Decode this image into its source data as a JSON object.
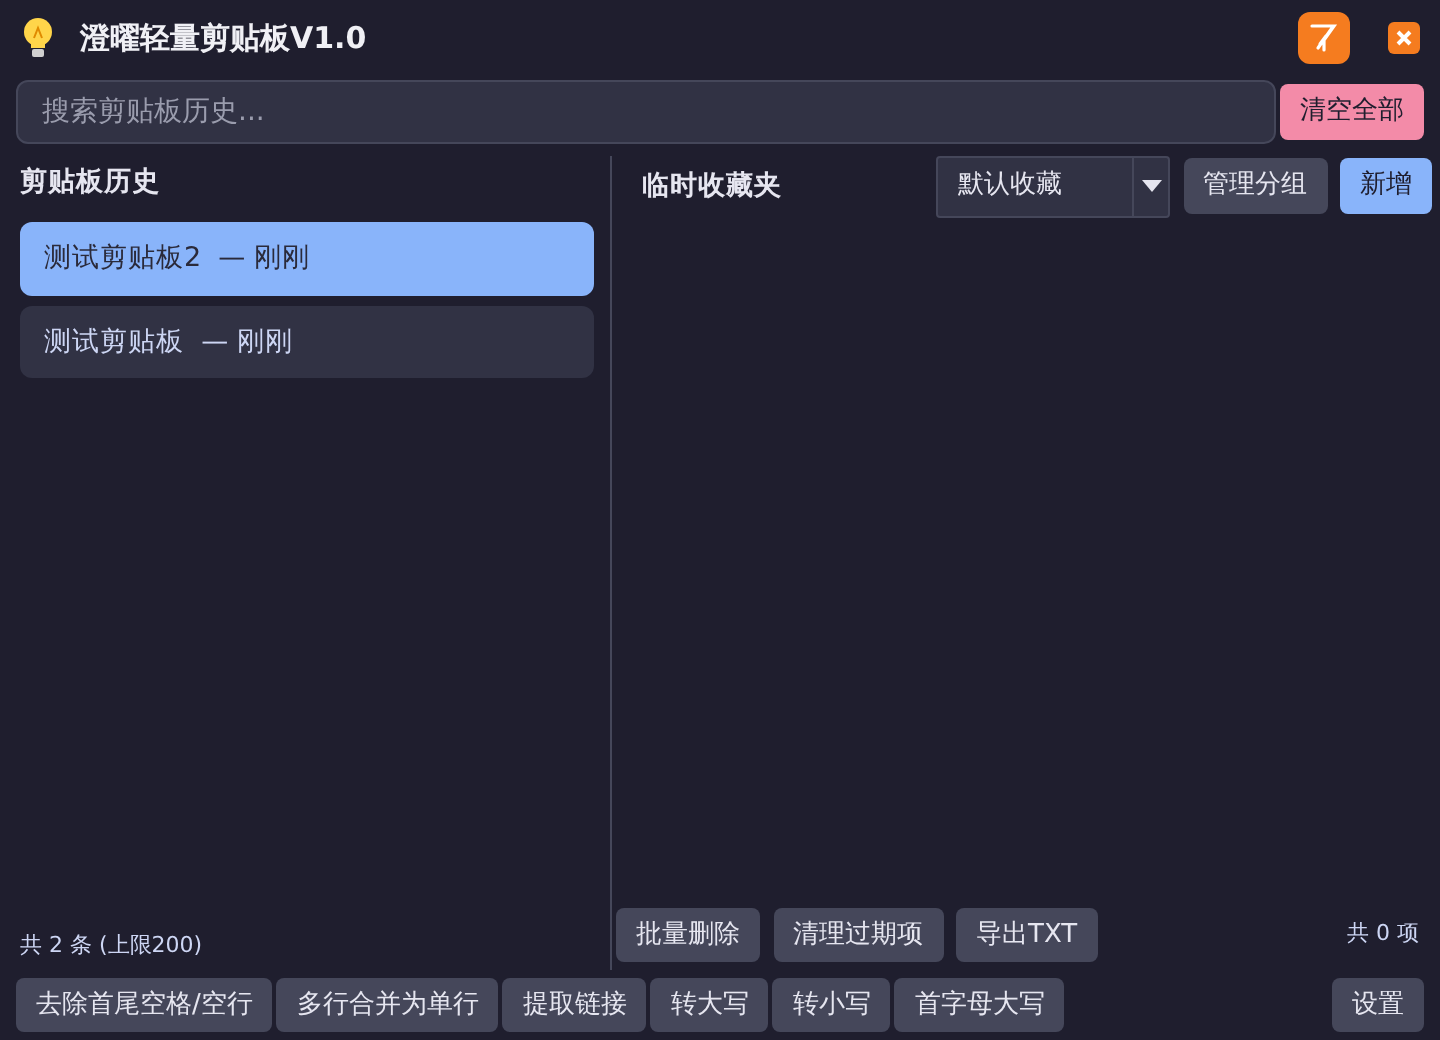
{
  "window": {
    "title": "澄曜轻量剪贴板V1.0"
  },
  "search": {
    "placeholder": "搜索剪贴板历史..."
  },
  "clear_all_button": "清空全部",
  "history": {
    "title": "剪贴板历史",
    "items": [
      {
        "text": "测试剪贴板2  — 刚刚",
        "selected": true
      },
      {
        "text": "测试剪贴板  — 刚刚",
        "selected": false
      }
    ],
    "count": "共 2 条 (上限200)"
  },
  "favorites": {
    "title": "临时收藏夹",
    "group_select": "默认收藏",
    "buttons": [
      {
        "label": "管理分组",
        "kind": "secondary"
      },
      {
        "label": "新增",
        "kind": "primary"
      }
    ],
    "actions": [
      "批量删除",
      "清理过期项",
      "导出TXT"
    ],
    "count": "共 0 项"
  },
  "toolbar": {
    "buttons": [
      "去除首尾空格/空行",
      "多行合并为单行",
      "提取链接",
      "转大写",
      "转小写",
      "首字母大写"
    ],
    "settings": "设置"
  }
}
